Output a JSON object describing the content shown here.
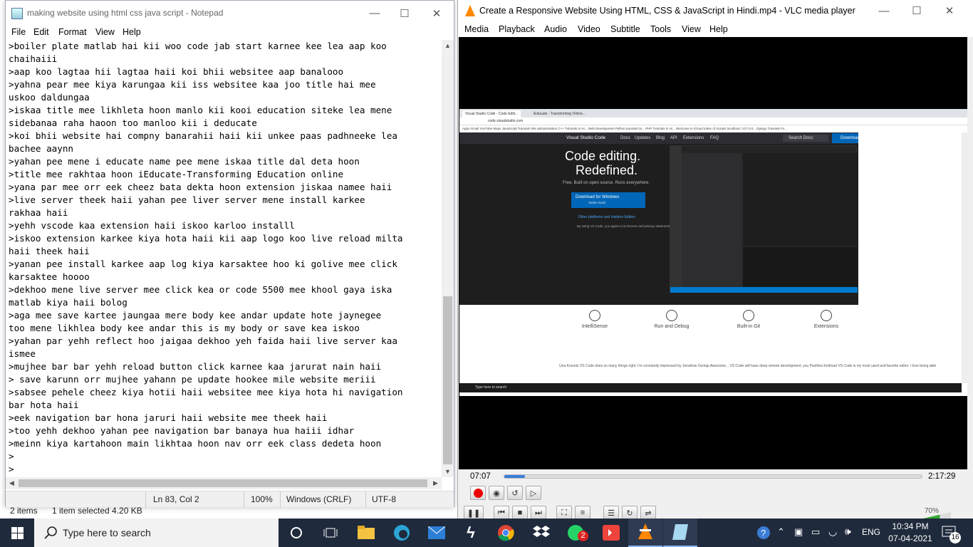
{
  "explorer": {
    "items_count": "2 items",
    "selected": "1 item selected  4.20 KB"
  },
  "notepad": {
    "title": "making website using html css java script - Notepad",
    "menu": [
      "File",
      "Edit",
      "Format",
      "View",
      "Help"
    ],
    "lines": [
      ">boiler plate matlab hai kii woo code jab start karnee kee lea aap koo",
      "chaihaiii",
      ">aap koo lagtaa hii lagtaa haii koi bhii websitee aap banalooo",
      ">yahna pear mee kiya karungaa kii iss websitee kaa joo title hai mee",
      "uskoo daldungaa",
      ">iskaa title mee likhleta hoon manlo kii kooi education siteke lea mene",
      "sidebanaa raha haoon too manloo kii i deducate",
      ">koi bhii website hai compny banarahii haii kii unkee paas padhneeke lea",
      "bachee aaynn",
      ">yahan pee mene i educate name pee mene iskaa title dal deta hoon",
      ">title mee rakhtaa hoon iEducate-Transforming Education online",
      ">yana par mee orr eek cheez bata dekta hoon extension jiskaa namee haii",
      ">live server theek haii yahan pee liver server mene install karkee",
      "rakhaa haii",
      ">yehh vscode kaa extension haii iskoo karloo installl",
      ">iskoo extension karkee kiya hota haii kii aap logo koo live reload milta",
      "haii theek haii",
      ">yanan pee install karkee aap log kiya karsaktee hoo ki golive mee click",
      "karsaktee hoooo",
      ">dekhoo mene live server mee click kea or code 5500 mee khool gaya iska",
      "matlab kiya haii bolog",
      ">aga mee save kartee jaungaa mere body kee andar update hote jaynegee",
      "too mene likhlea body kee andar this is my body or save kea iskoo",
      ">yahan par yehh reflect hoo jaigaa dekhoo yeh faida haii live server kaa",
      "ismee",
      ">mujhee bar bar yehh reload button click karnee kaa jarurat nain haii",
      "> save karunn orr mujhee yahann pe update hookee mile website meriii",
      ">sabsee pehele cheez kiya hotii haii websitee mee kiya hota hi navigation",
      "bar hota haii",
      ">eek navigation bar hona jaruri haii website mee theek haii",
      ">too yehh dekhoo yahan pee navigation bar banaya hua haiii idhar",
      ">meinn kiya kartahoon main likhtaa hoon nav orr eek class dedeta hoon",
      ">",
      ">"
    ],
    "status": {
      "position": "Ln 83, Col 2",
      "zoom": "100%",
      "line_ending": "Windows (CRLF)",
      "encoding": "UTF-8"
    }
  },
  "vlc": {
    "title": "Create a Responsive Website Using HTML, CSS & JavaScript in Hindi.mp4 - VLC media player",
    "menu": [
      "Media",
      "Playback",
      "Audio",
      "Video",
      "Subtitle",
      "Tools",
      "View",
      "Help"
    ],
    "elapsed": "07:07",
    "total": "2:17:29",
    "progress_fraction": 0.05,
    "volume": "70%",
    "volume_fraction": 0.7,
    "accent_color": "#3b7dd8"
  },
  "video_frame": {
    "tabs": [
      "Visual Studio Code - Code Editi...",
      "iEducate - Transforming Online..."
    ],
    "url": "code.visualstudio.com",
    "bookmarks": "Apps  Gmail  YouTube  Maps  JavaScript Tutorials  Site administration  C++ Tutorials In Hi...  Web Development  Python tutorials for...  PHP Tutorials In Hi...  Welcome to iCloud  Index of /scripts  localhost / 127.0.0...  Django Tutorials Fo...",
    "nav_brand": "Visual Studio Code",
    "nav_links": [
      "Docs",
      "Updates",
      "Blog",
      "API",
      "Extensions",
      "FAQ"
    ],
    "nav_search": "Search Docs",
    "nav_download": "Download",
    "hero_line1": "Code editing.",
    "hero_line2": "Redefined.",
    "hero_sub": "Free. Built on open source. Runs everywhere.",
    "download_btn": "Download for Windows",
    "download_sub": "Stable Build",
    "other_platforms": "Other platforms and Insiders Edition",
    "agree": "By using VS Code, you agree to its license and privacy statement.",
    "features": [
      "IntelliSense",
      "Run and Debug",
      "Built-in Git",
      "Extensions"
    ],
    "tweets": "Una Kravets  VS Code does so many things right. I'm constantly impressed by   Jonathan Dunlap  Awesome... VS Code will have deep remote development, you   Pavithra Kodmad  VS Code is my most used and favorite editor. I love being able",
    "taskbar_search": "Type here to search"
  },
  "taskbar": {
    "search_placeholder": "Type here to search",
    "whatsapp_badge": "2",
    "language": "ENG",
    "time": "10:34 PM",
    "date": "07-04-2021",
    "notification_count": "16"
  }
}
